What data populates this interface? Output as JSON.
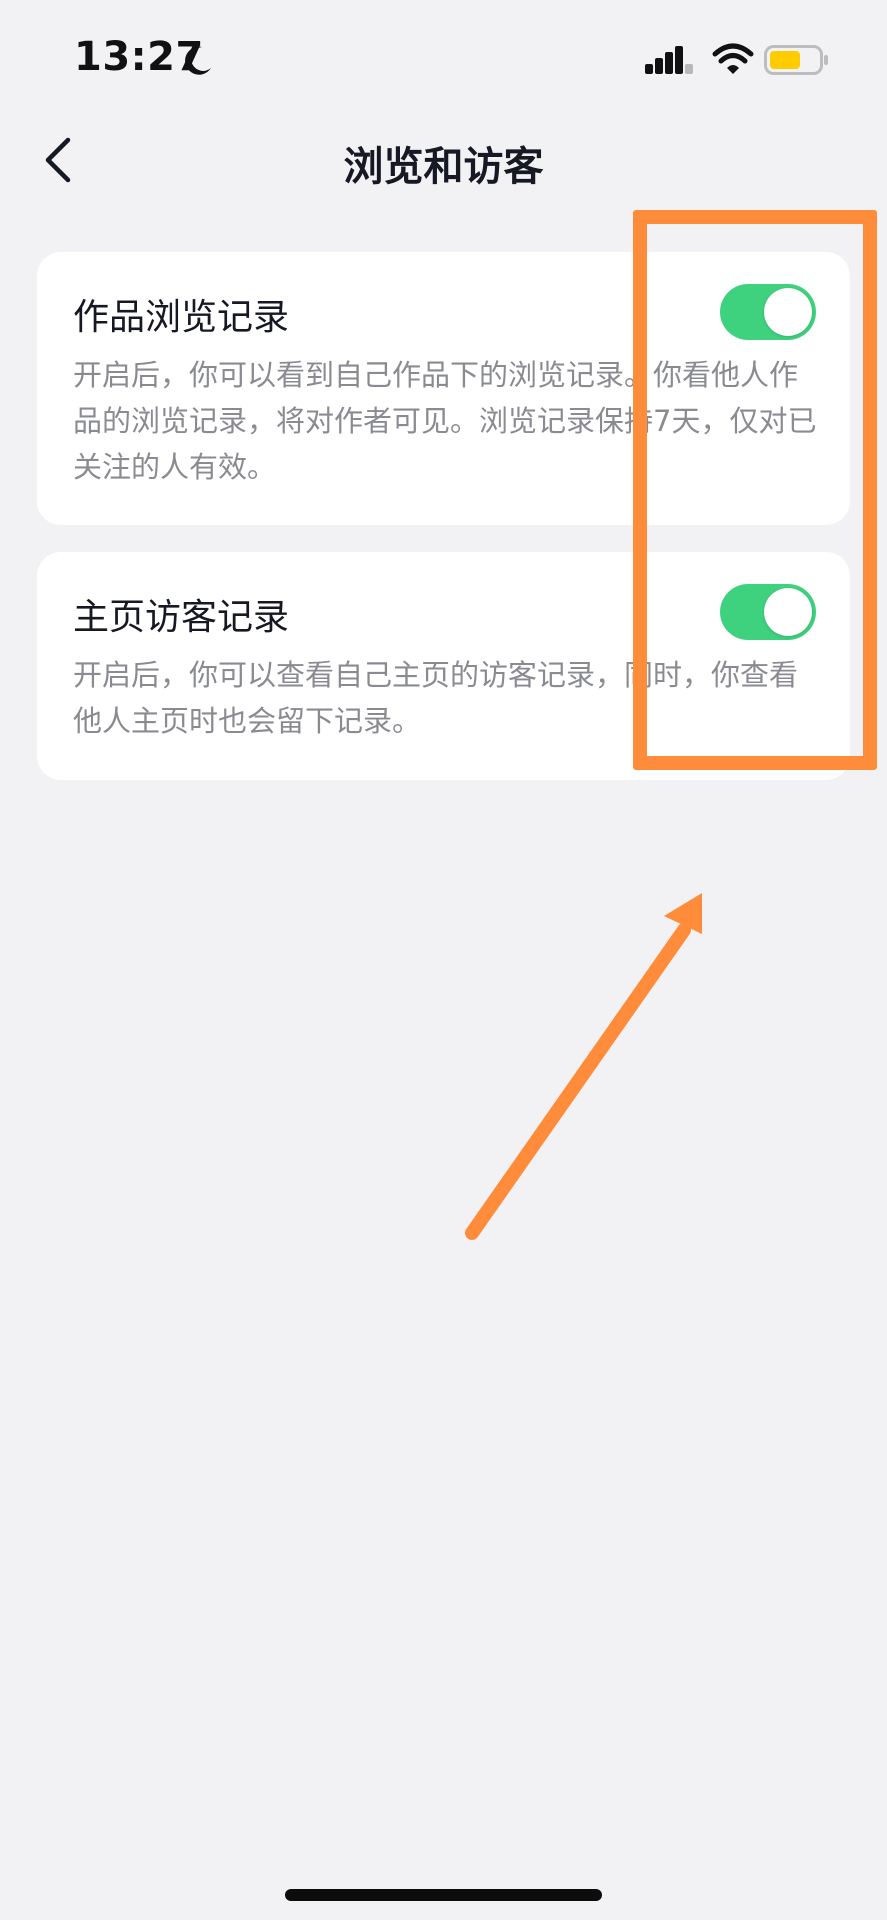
{
  "status_bar": {
    "time": "13:27",
    "icons": [
      "moon-icon",
      "signal-icon",
      "wifi-icon",
      "battery-icon"
    ],
    "battery_color": "#ffcc00"
  },
  "nav": {
    "title": "浏览和访客",
    "back_icon": "chevron-left-icon"
  },
  "settings": [
    {
      "title": "作品浏览记录",
      "description": "开启后，你可以看到自己作品下的浏览记录。你看他人作品的浏览记录，将对作者可见。浏览记录保持7天，仅对已关注的人有效。",
      "enabled": true
    },
    {
      "title": "主页访客记录",
      "description": "开启后，你可以查看自己主页的访客记录，同时，你查看他人主页时也会留下记录。",
      "enabled": true
    }
  ],
  "colors": {
    "toggle_on": "#3ed27f",
    "annotation": "#ff8c3a",
    "background": "#f2f1f4"
  }
}
